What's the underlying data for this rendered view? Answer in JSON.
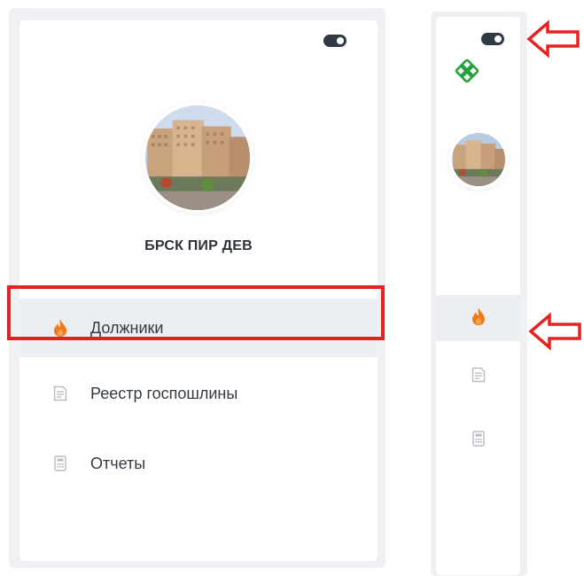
{
  "expanded_sidebar": {
    "org_name": "БРСК ПИР ДЕВ",
    "menu": [
      {
        "label": "Должники",
        "icon": "flame-icon",
        "active": true
      },
      {
        "label": "Реестр госпошлины",
        "icon": "document-icon",
        "active": false
      },
      {
        "label": "Отчеты",
        "icon": "calculator-icon",
        "active": false
      }
    ]
  },
  "collapsed_sidebar": {
    "logo_icon": "green-knot-logo-icon",
    "menu_icons": [
      "flame-icon",
      "document-icon",
      "calculator-icon"
    ]
  },
  "annotations": {
    "highlight_color": "#e52222",
    "arrow_color": "#e52222"
  },
  "colors": {
    "accent_flame": "#f07a1a",
    "active_bg": "#ebeef3",
    "toggle": "#2f3a46"
  }
}
